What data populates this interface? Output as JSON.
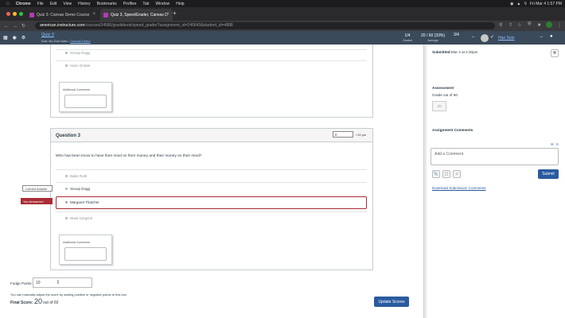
{
  "menubar": {
    "app": "Chrome",
    "items": [
      "File",
      "Edit",
      "View",
      "History",
      "Bookmarks",
      "Profiles",
      "Tab",
      "Window",
      "Help"
    ],
    "clock": "Fri Mar 4  1:57 PM"
  },
  "tabs": [
    {
      "title": "Quiz 3: Canvas Demo Course",
      "close": "×"
    },
    {
      "title": "Quiz 3, SpeedGrader, Canvas D",
      "close": "×"
    }
  ],
  "new_tab": "+",
  "address": {
    "host": "american.instructure.com",
    "path": "/courses/24586/gradebook/speed_grader?assignment_id=245643&student_id=4888"
  },
  "header": {
    "quiz_title": "Quiz 3",
    "due": "Due: No Due Date",
    "sep": " - ",
    "course": "Canvas Demo",
    "graded_value": "1/4",
    "graded_label": "Graded",
    "average_value": "20 / 60 (33%)",
    "average_label": "Average",
    "student_nav": "3/4",
    "student_name": "Han Solo"
  },
  "question2": {
    "answers": [
      "Snoop Dogg",
      "Hans Gruber"
    ],
    "comments_label": "Additional Comments"
  },
  "question3": {
    "title": "Question 3",
    "points_value": "0",
    "points_of": "/ 50 pts",
    "prompt": "Who has been know to have their mind on their money and their money on their mind?",
    "answers": [
      "Babe Ruth",
      "Snoop Dogg",
      "Margaret Thatcher",
      "Newt Gingrich"
    ],
    "correct_tag": "Correct Answer",
    "you_tag": "You Answered",
    "comments_label": "Additional Comments"
  },
  "footer": {
    "fudge_label": "Fudge Points:",
    "fudge_value": "10",
    "hint": "You can manually adjust the score by adding positive or negative points to this box.",
    "final_label": "Final Score:",
    "final_value": "20",
    "final_of": "out of 60",
    "update_button": "Update Scores"
  },
  "right": {
    "submitted_label": "Submitted:",
    "submitted_value": "Mar 4 at 4:30pm",
    "assessment": "Assessment",
    "grade_label": "Grade out of 60",
    "grade_value": "20",
    "comments_heading": "Assignment Comments",
    "comment_count": "0",
    "comment_placeholder": "Add a Comment",
    "submit": "Submit",
    "download_link": "Download Submission Comments"
  },
  "colors": {
    "header_bg": "#3a4a5a",
    "you_answered": "#a92d35",
    "button_blue": "#2a5a9f"
  }
}
